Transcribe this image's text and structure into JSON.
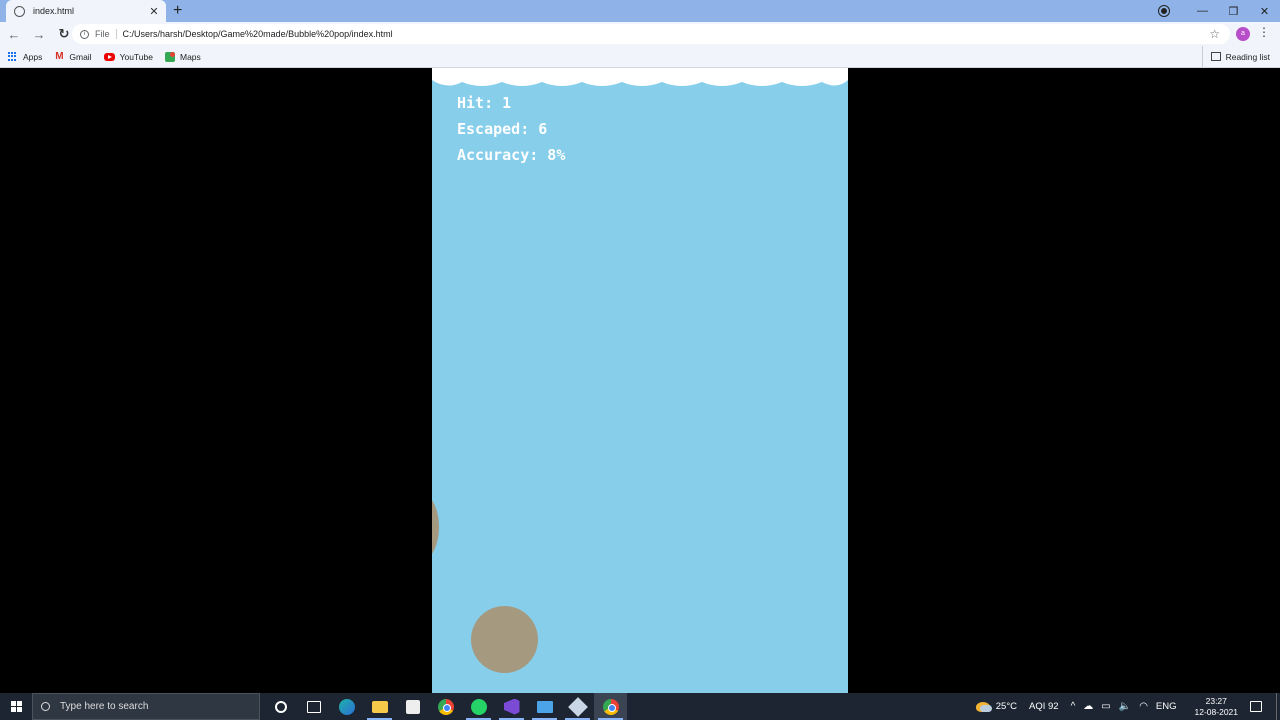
{
  "browser": {
    "tab_title": "index.html",
    "tab_close": "✕",
    "new_tab": "+",
    "url_scheme": "File",
    "url": "C:/Users/harsh/Desktop/Game%20made/Bubble%20pop/index.html",
    "profile_initial": "a",
    "bookmarks": [
      {
        "label": "Apps",
        "icon": "apps-icon"
      },
      {
        "label": "Gmail",
        "icon": "gmail-icon"
      },
      {
        "label": "YouTube",
        "icon": "youtube-icon"
      },
      {
        "label": "Maps",
        "icon": "maps-icon"
      }
    ],
    "reading_list": "Reading list",
    "window_controls": {
      "minimize": "—",
      "restore": "❐",
      "close": "✕"
    }
  },
  "game": {
    "hud": {
      "hit": "Hit: 1",
      "escaped": "Escaped: 6",
      "accuracy": "Accuracy: 8%"
    },
    "colors": {
      "background": "#87ceeb",
      "bubble": "#a59a80",
      "clouds": "#ffffff"
    }
  },
  "taskbar": {
    "search_placeholder": "Type here to search",
    "apps": [
      "cortana-icon",
      "task-view-icon",
      "edge-icon",
      "file-explorer-icon",
      "store-icon",
      "chrome-icon",
      "whatsapp-icon",
      "visual-studio-icon",
      "remote-desktop-icon",
      "minecraft-icon",
      "chrome-active-icon"
    ],
    "weather": "25°C",
    "aqi": "AQI 92",
    "language": "ENG",
    "time": "23:27",
    "date": "12-08-2021"
  }
}
